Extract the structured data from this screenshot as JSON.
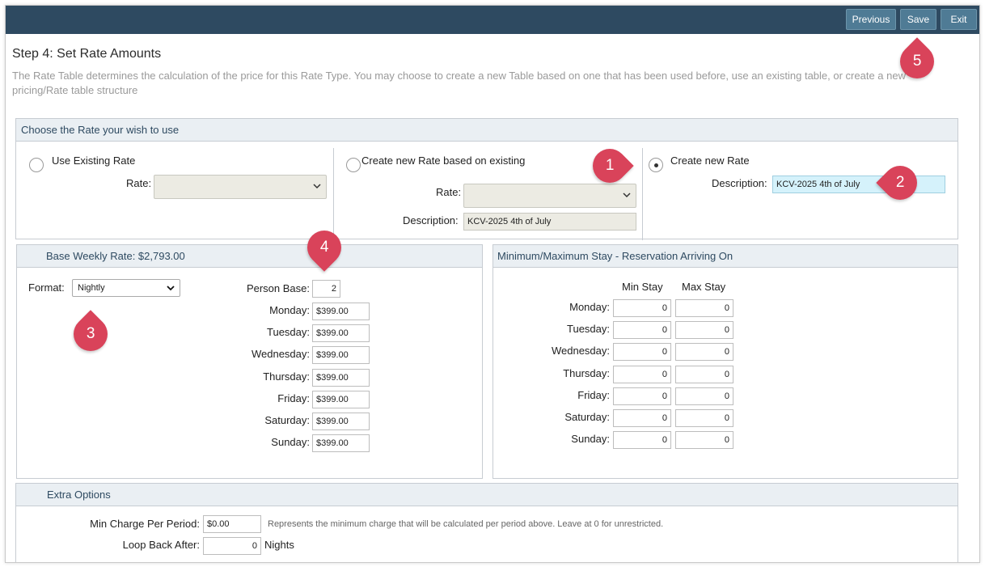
{
  "toolbar": {
    "previous": "Previous",
    "save": "Save",
    "exit": "Exit"
  },
  "page": {
    "title": "Step 4: Set Rate Amounts",
    "intro": "The Rate Table determines the calculation of the price for this Rate Type. You may choose to create a new Table based on one that has been used before, use an existing table, or create a new pricing/Rate table structure"
  },
  "choose": {
    "header": "Choose the Rate your wish to use",
    "existing": {
      "label": "Use Existing Rate",
      "rate_label": "Rate:",
      "rate_value": ""
    },
    "based": {
      "label": "Create new Rate based on existing",
      "rate_label": "Rate:",
      "rate_value": "",
      "desc_label": "Description:",
      "desc_value": "KCV-2025 4th of July"
    },
    "new": {
      "label": "Create new Rate",
      "desc_label": "Description:",
      "desc_value": "KCV-2025 4th of July",
      "selected": true
    }
  },
  "base": {
    "header": "Base Weekly Rate: $2,793.00",
    "format_label": "Format:",
    "format_value": "Nightly",
    "person_base_label": "Person Base:",
    "person_base_value": "2",
    "days": [
      {
        "label": "Monday:",
        "value": "$399.00"
      },
      {
        "label": "Tuesday:",
        "value": "$399.00"
      },
      {
        "label": "Wednesday:",
        "value": "$399.00"
      },
      {
        "label": "Thursday:",
        "value": "$399.00"
      },
      {
        "label": "Friday:",
        "value": "$399.00"
      },
      {
        "label": "Saturday:",
        "value": "$399.00"
      },
      {
        "label": "Sunday:",
        "value": "$399.00"
      }
    ]
  },
  "stay": {
    "header": "Minimum/Maximum Stay - Reservation Arriving On",
    "min_header": "Min Stay",
    "max_header": "Max Stay",
    "days": [
      {
        "label": "Monday:",
        "min": "0",
        "max": "0"
      },
      {
        "label": "Tuesday:",
        "min": "0",
        "max": "0"
      },
      {
        "label": "Wednesday:",
        "min": "0",
        "max": "0"
      },
      {
        "label": "Thursday:",
        "min": "0",
        "max": "0"
      },
      {
        "label": "Friday:",
        "min": "0",
        "max": "0"
      },
      {
        "label": "Saturday:",
        "min": "0",
        "max": "0"
      },
      {
        "label": "Sunday:",
        "min": "0",
        "max": "0"
      }
    ]
  },
  "extra": {
    "header": "Extra Options",
    "min_charge_label": "Min Charge Per Period:",
    "min_charge_value": "$0.00",
    "min_charge_note": "Represents the minimum charge that will be calculated per period above. Leave at 0 for unrestricted.",
    "loop_label": "Loop Back After:",
    "loop_value": "0",
    "loop_unit": "Nights"
  },
  "callouts": [
    "1",
    "2",
    "3",
    "4",
    "5"
  ],
  "colors": {
    "topbar": "#2e4a61",
    "button": "#4f7b95",
    "callout": "#d9435a",
    "panel_header": "#eaeff3"
  }
}
